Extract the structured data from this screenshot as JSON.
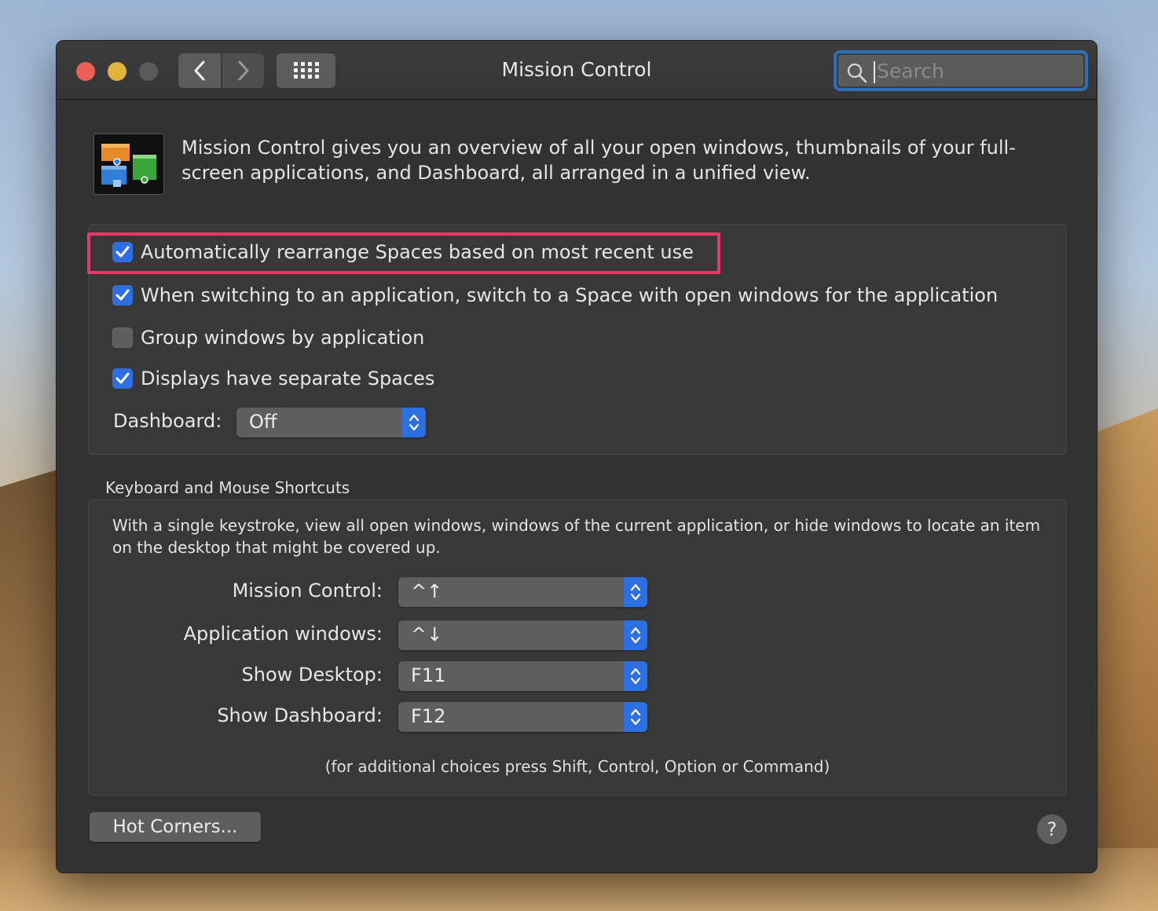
{
  "window": {
    "title": "Mission Control"
  },
  "search": {
    "placeholder": "Search"
  },
  "intro": {
    "text": "Mission Control gives you an overview of all your open windows, thumbnails of your full-screen applications, and Dashboard, all arranged in a unified view."
  },
  "options": [
    {
      "label": "Automatically rearrange Spaces based on most recent use",
      "checked": true
    },
    {
      "label": "When switching to an application, switch to a Space with open windows for the application",
      "checked": true
    },
    {
      "label": "Group windows by application",
      "checked": false
    },
    {
      "label": "Displays have separate Spaces",
      "checked": true
    }
  ],
  "dashboard": {
    "label": "Dashboard:",
    "value": "Off"
  },
  "shortcuts": {
    "title": "Keyboard and Mouse Shortcuts",
    "description": "With a single keystroke, view all open windows, windows of the current application, or hide windows to locate an item on the desktop that might be covered up.",
    "items": [
      {
        "label": "Mission Control:",
        "value": "^↑"
      },
      {
        "label": "Application windows:",
        "value": "^↓"
      },
      {
        "label": "Show Desktop:",
        "value": "F11"
      },
      {
        "label": "Show Dashboard:",
        "value": "F12"
      }
    ],
    "hint": "(for additional choices press Shift, Control, Option or Command)"
  },
  "buttons": {
    "hot_corners": "Hot Corners...",
    "help": "?"
  },
  "colors": {
    "accent": "#2c6fe3",
    "highlight": "#e8386a",
    "window_bg": "#323232"
  }
}
